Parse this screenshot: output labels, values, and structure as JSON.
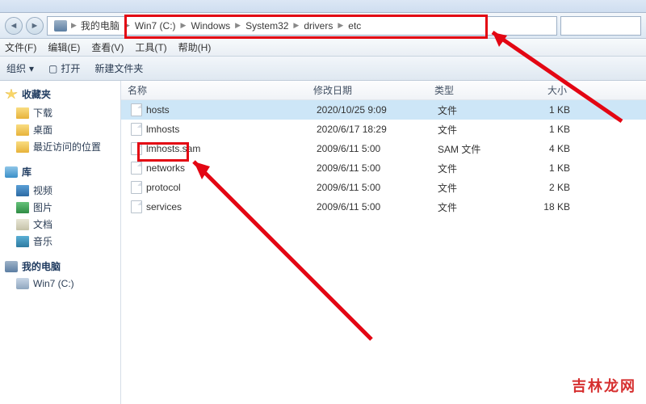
{
  "breadcrumb": {
    "root": "我的电脑",
    "segs": [
      "Win7 (C:)",
      "Windows",
      "System32",
      "drivers",
      "etc"
    ]
  },
  "menubar": {
    "file": "文件(F)",
    "edit": "编辑(E)",
    "view": "查看(V)",
    "tools": "工具(T)",
    "help": "帮助(H)"
  },
  "toolbar": {
    "organize": "组织",
    "open": "打开",
    "newfolder": "新建文件夹"
  },
  "columns": {
    "name": "名称",
    "date": "修改日期",
    "type": "类型",
    "size": "大小"
  },
  "files": [
    {
      "name": "hosts",
      "date": "2020/10/25 9:09",
      "type": "文件",
      "size": "1 KB",
      "selected": true
    },
    {
      "name": "lmhosts",
      "date": "2020/6/17 18:29",
      "type": "文件",
      "size": "1 KB"
    },
    {
      "name": "lmhosts.sam",
      "date": "2009/6/11 5:00",
      "type": "SAM 文件",
      "size": "4 KB"
    },
    {
      "name": "networks",
      "date": "2009/6/11 5:00",
      "type": "文件",
      "size": "1 KB"
    },
    {
      "name": "protocol",
      "date": "2009/6/11 5:00",
      "type": "文件",
      "size": "2 KB"
    },
    {
      "name": "services",
      "date": "2009/6/11 5:00",
      "type": "文件",
      "size": "18 KB"
    }
  ],
  "sidebar": {
    "favorites": {
      "label": "收藏夹",
      "items": [
        "下载",
        "桌面",
        "最近访问的位置"
      ]
    },
    "libraries": {
      "label": "库",
      "items": [
        "视频",
        "图片",
        "文档",
        "音乐"
      ]
    },
    "computer": {
      "label": "我的电脑",
      "items": [
        "Win7 (C:)"
      ]
    }
  },
  "watermark": "吉林龙网"
}
